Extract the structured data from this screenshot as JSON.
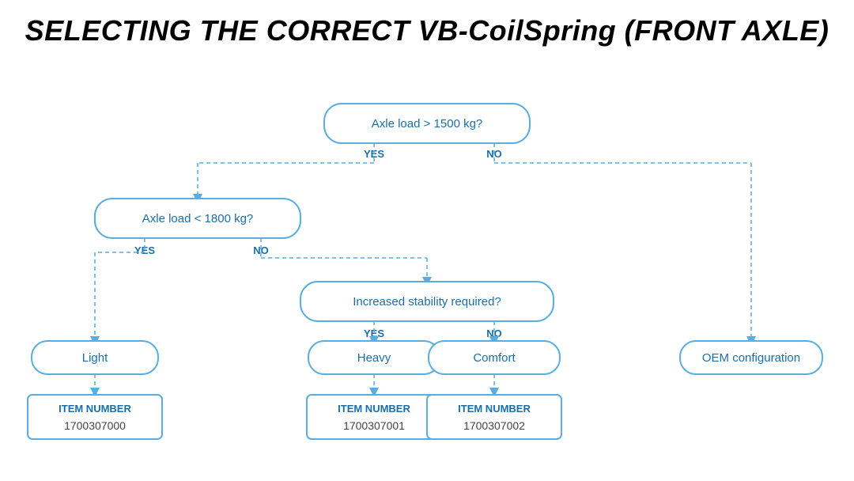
{
  "title": "SELECTING THE CORRECT VB-CoilSpring (FRONT AXLE)",
  "nodes": {
    "root": {
      "label": "Axle load > 1500 kg?",
      "yes": "YES",
      "no": "NO"
    },
    "left_branch": {
      "label": "Axle load < 1800 kg?",
      "yes": "YES",
      "no": "NO"
    },
    "right_branch": {
      "label": "Increased stability required?",
      "yes": "YES",
      "no": "NO"
    },
    "light": {
      "label": "Light"
    },
    "heavy": {
      "label": "Heavy"
    },
    "comfort": {
      "label": "Comfort"
    },
    "oem": {
      "label": "OEM configuration"
    }
  },
  "items": {
    "item0": {
      "prefix": "ITEM NUMBER",
      "number": "1700307000"
    },
    "item1": {
      "prefix": "ITEM NUMBER",
      "number": "1700307001"
    },
    "item2": {
      "prefix": "ITEM NUMBER",
      "number": "1700307002"
    }
  },
  "colors": {
    "blue_border": "#5aade0",
    "blue_text": "#1a6fa8",
    "blue_dark": "#1a6fa8",
    "black": "#000000",
    "white": "#ffffff",
    "dashed": "#5aade0"
  }
}
